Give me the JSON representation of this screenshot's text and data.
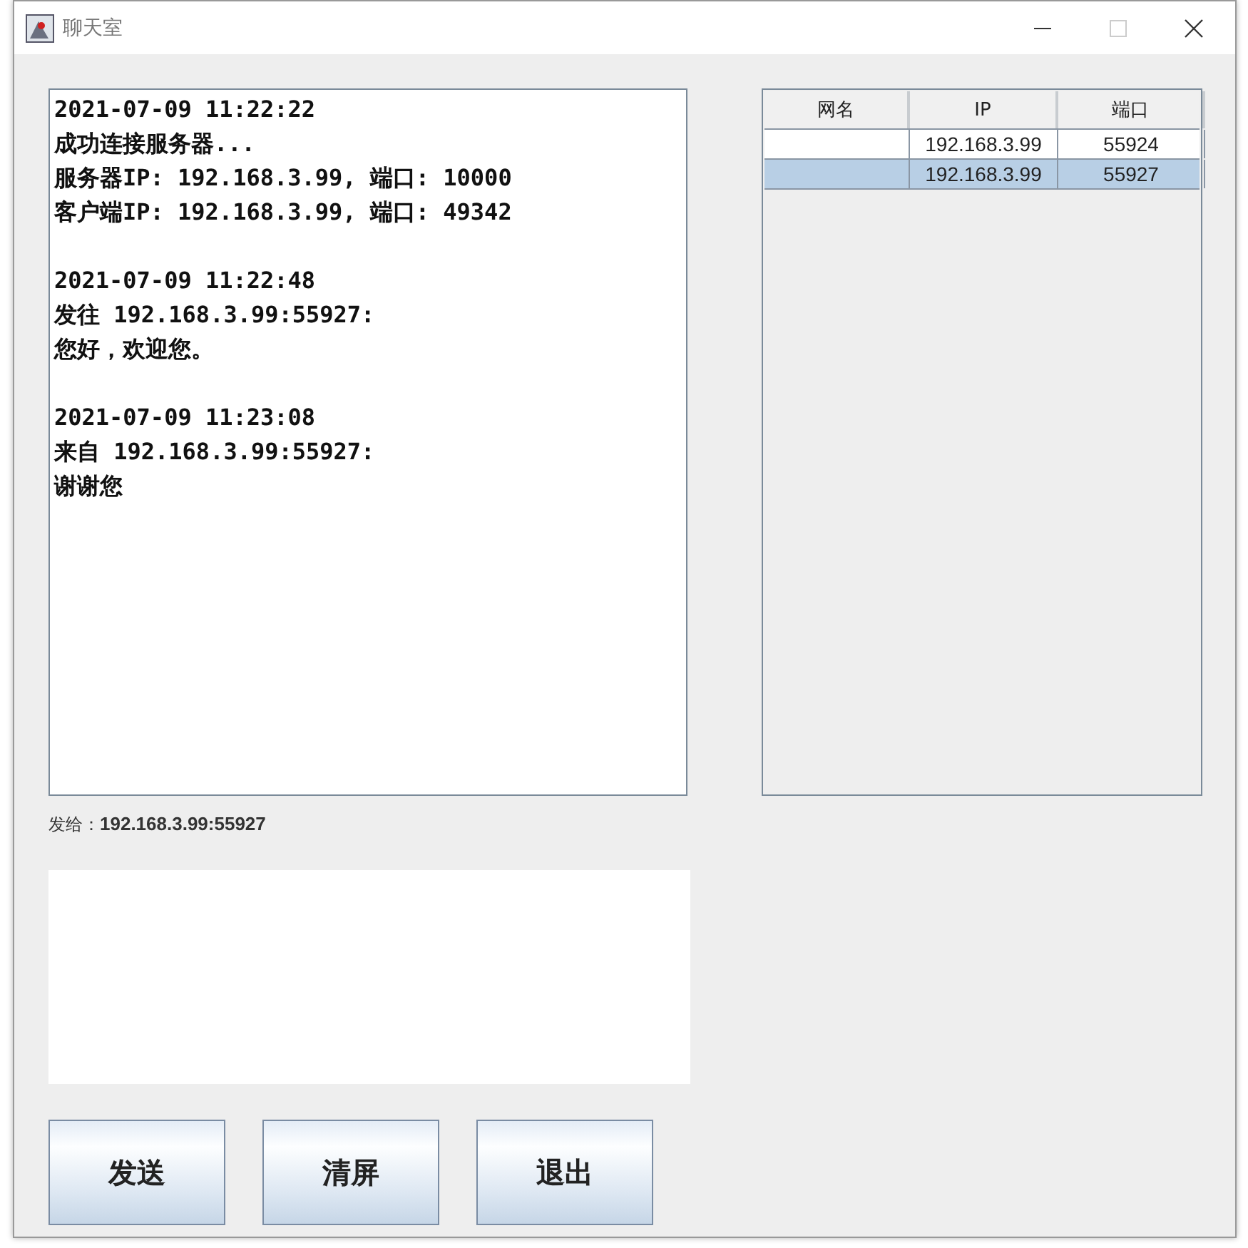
{
  "window": {
    "title": "聊天室"
  },
  "chat_log": [
    {
      "lines": [
        "2021-07-09 11:22:22",
        "成功连接服务器...",
        "服务器IP: 192.168.3.99, 端口: 10000",
        "客户端IP: 192.168.3.99, 端口: 49342"
      ]
    },
    {
      "lines": [
        "2021-07-09 11:22:48",
        "发往 192.168.3.99:55927:",
        "您好，欢迎您。"
      ]
    },
    {
      "lines": [
        "2021-07-09 11:23:08",
        "来自 192.168.3.99:55927:",
        "谢谢您"
      ]
    }
  ],
  "table": {
    "columns": [
      "网名",
      "IP",
      "端口"
    ],
    "rows": [
      {
        "ip": "192.168.3.99",
        "port": "55924",
        "selected": false
      },
      {
        "ip": "192.168.3.99",
        "port": "55927",
        "selected": true
      }
    ]
  },
  "send_to": {
    "label": "发给：",
    "address": "192.168.3.99:55927"
  },
  "buttons": [
    "发送",
    "清屏",
    "退出"
  ]
}
